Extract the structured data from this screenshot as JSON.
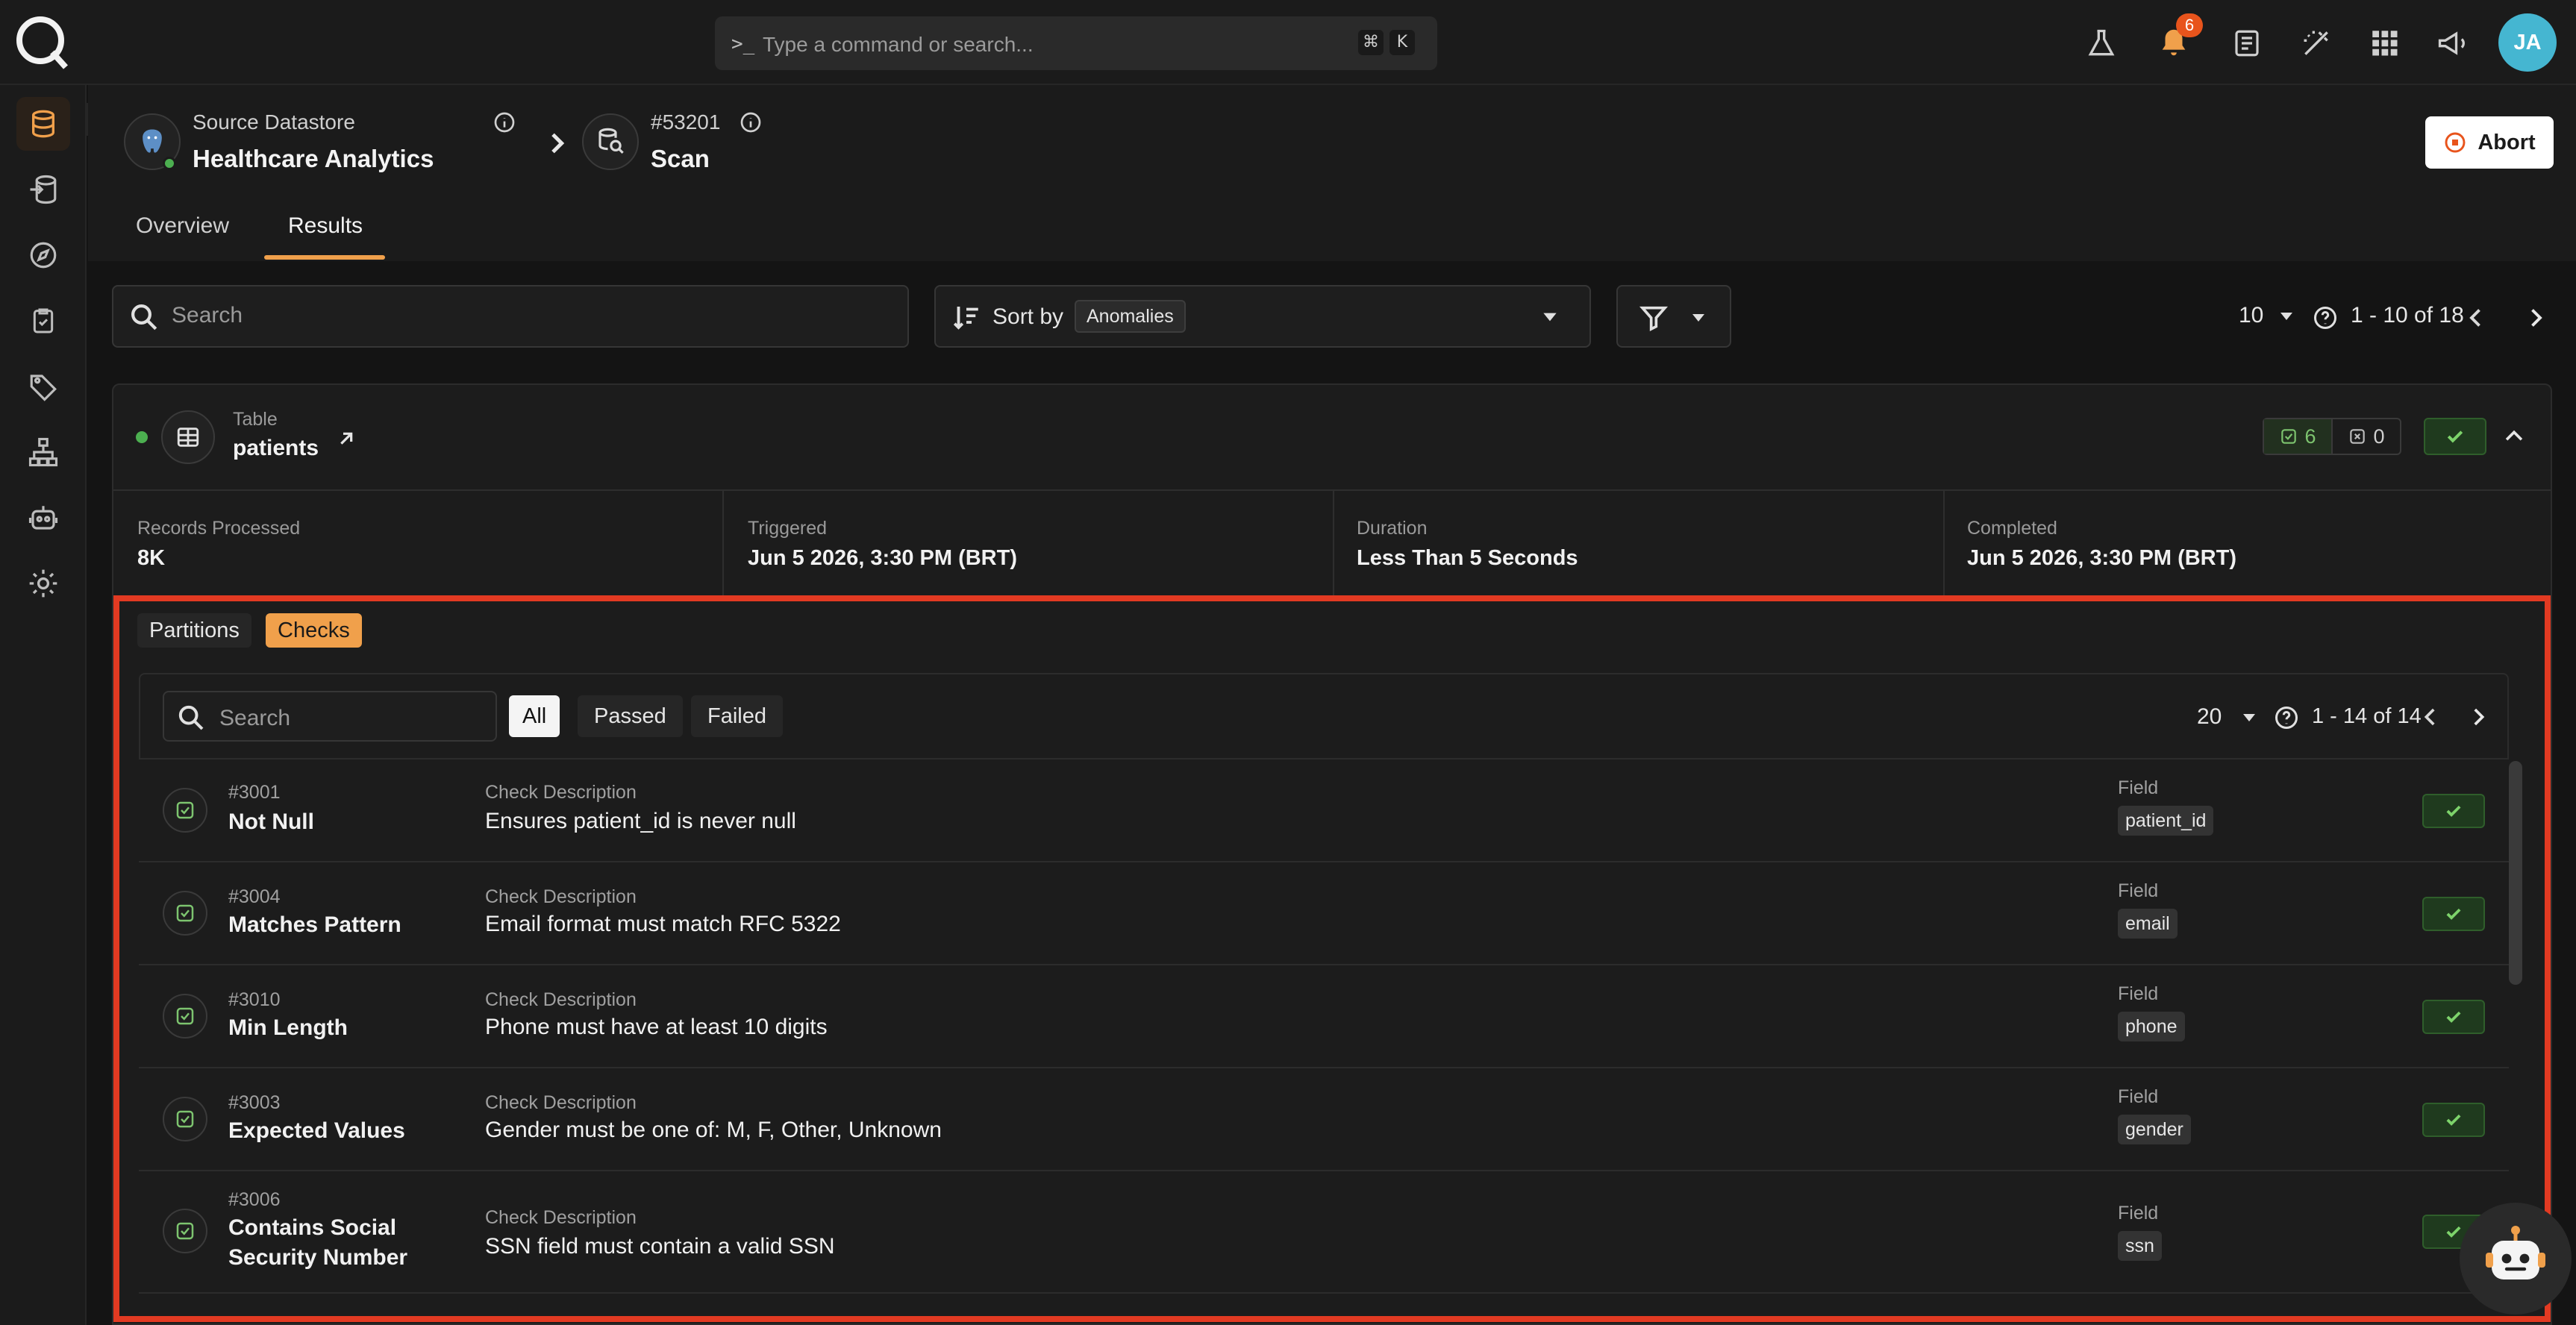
{
  "topbar": {
    "command_placeholder": "Type a command or search...",
    "shortcut_modifier": "⌘",
    "shortcut_key": "K",
    "notification_count": "6",
    "user_initials": "JA"
  },
  "breadcrumb": {
    "source_label": "Source Datastore",
    "source_name": "Healthcare Analytics",
    "scan_id": "#53201",
    "scan_label": "Scan"
  },
  "actions": {
    "abort_label": "Abort"
  },
  "tabs": [
    {
      "label": "Overview",
      "active": false
    },
    {
      "label": "Results",
      "active": true
    }
  ],
  "toolbar": {
    "search_placeholder": "Search",
    "sort_label": "Sort by",
    "sort_value": "Anomalies",
    "page_size": "10",
    "range": "1 - 10 of 18"
  },
  "container": {
    "type_label": "Table",
    "name": "patients",
    "passed_count": "6",
    "failed_count": "0"
  },
  "stats": [
    {
      "label": "Records Processed",
      "value": "8K"
    },
    {
      "label": "Triggered",
      "value": "Jun 5 2026, 3:30 PM (BRT)"
    },
    {
      "label": "Duration",
      "value": "Less Than 5 Seconds"
    },
    {
      "label": "Completed",
      "value": "Jun 5 2026, 3:30 PM (BRT)"
    }
  ],
  "subtabs": [
    {
      "label": "Partitions",
      "active": false
    },
    {
      "label": "Checks",
      "active": true
    }
  ],
  "checks_toolbar": {
    "search_placeholder": "Search",
    "filters": [
      "All",
      "Passed",
      "Failed"
    ],
    "page_size": "20",
    "range": "1 - 14 of 14"
  },
  "checks": [
    {
      "id": "#3001",
      "name": "Not Null",
      "desc_label": "Check Description",
      "description": "Ensures patient_id is never null",
      "field_label": "Field",
      "field": "patient_id"
    },
    {
      "id": "#3004",
      "name": "Matches Pattern",
      "desc_label": "Check Description",
      "description": "Email format must match RFC 5322",
      "field_label": "Field",
      "field": "email"
    },
    {
      "id": "#3010",
      "name": "Min Length",
      "desc_label": "Check Description",
      "description": "Phone must have at least 10 digits",
      "field_label": "Field",
      "field": "phone"
    },
    {
      "id": "#3003",
      "name": "Expected Values",
      "desc_label": "Check Description",
      "description": "Gender must be one of: M, F, Other, Unknown",
      "field_label": "Field",
      "field": "gender"
    },
    {
      "id": "#3006",
      "name": "Contains Social Security Number",
      "desc_label": "Check Description",
      "description": "SSN field must contain a valid SSN",
      "field_label": "Field",
      "field": "ssn"
    }
  ],
  "colors": {
    "accent": "#f0a04b",
    "highlight": "#e23a22",
    "success": "#4caf50",
    "notification": "#e8541c"
  }
}
